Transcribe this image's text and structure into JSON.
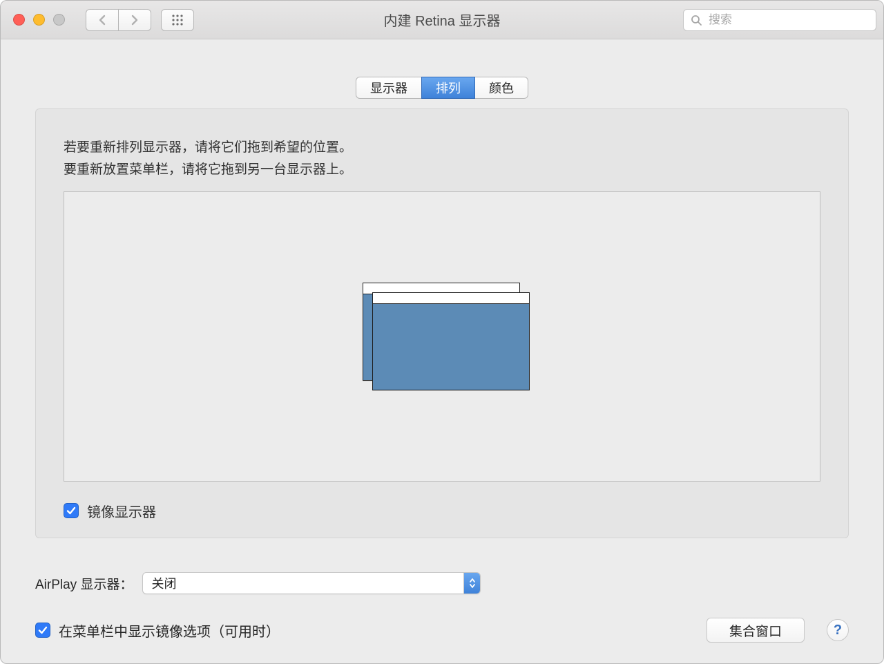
{
  "window": {
    "title": "内建 Retina 显示器"
  },
  "toolbar": {
    "search_placeholder": "搜索"
  },
  "tabs": [
    {
      "label": "显示器",
      "active": false
    },
    {
      "label": "排列",
      "active": true
    },
    {
      "label": "颜色",
      "active": false
    }
  ],
  "panel": {
    "instruction_line1": "若要重新排列显示器，请将它们拖到希望的位置。",
    "instruction_line2": "要重新放置菜单栏，请将它拖到另一台显示器上。",
    "mirror_label": "镜像显示器",
    "mirror_checked": true
  },
  "airplay": {
    "label": "AirPlay 显示器：",
    "selected": "关闭"
  },
  "footer": {
    "show_mirror_label": "在菜单栏中显示镜像选项（可用时）",
    "show_mirror_checked": true,
    "gather_label": "集合窗口",
    "help_label": "?"
  }
}
